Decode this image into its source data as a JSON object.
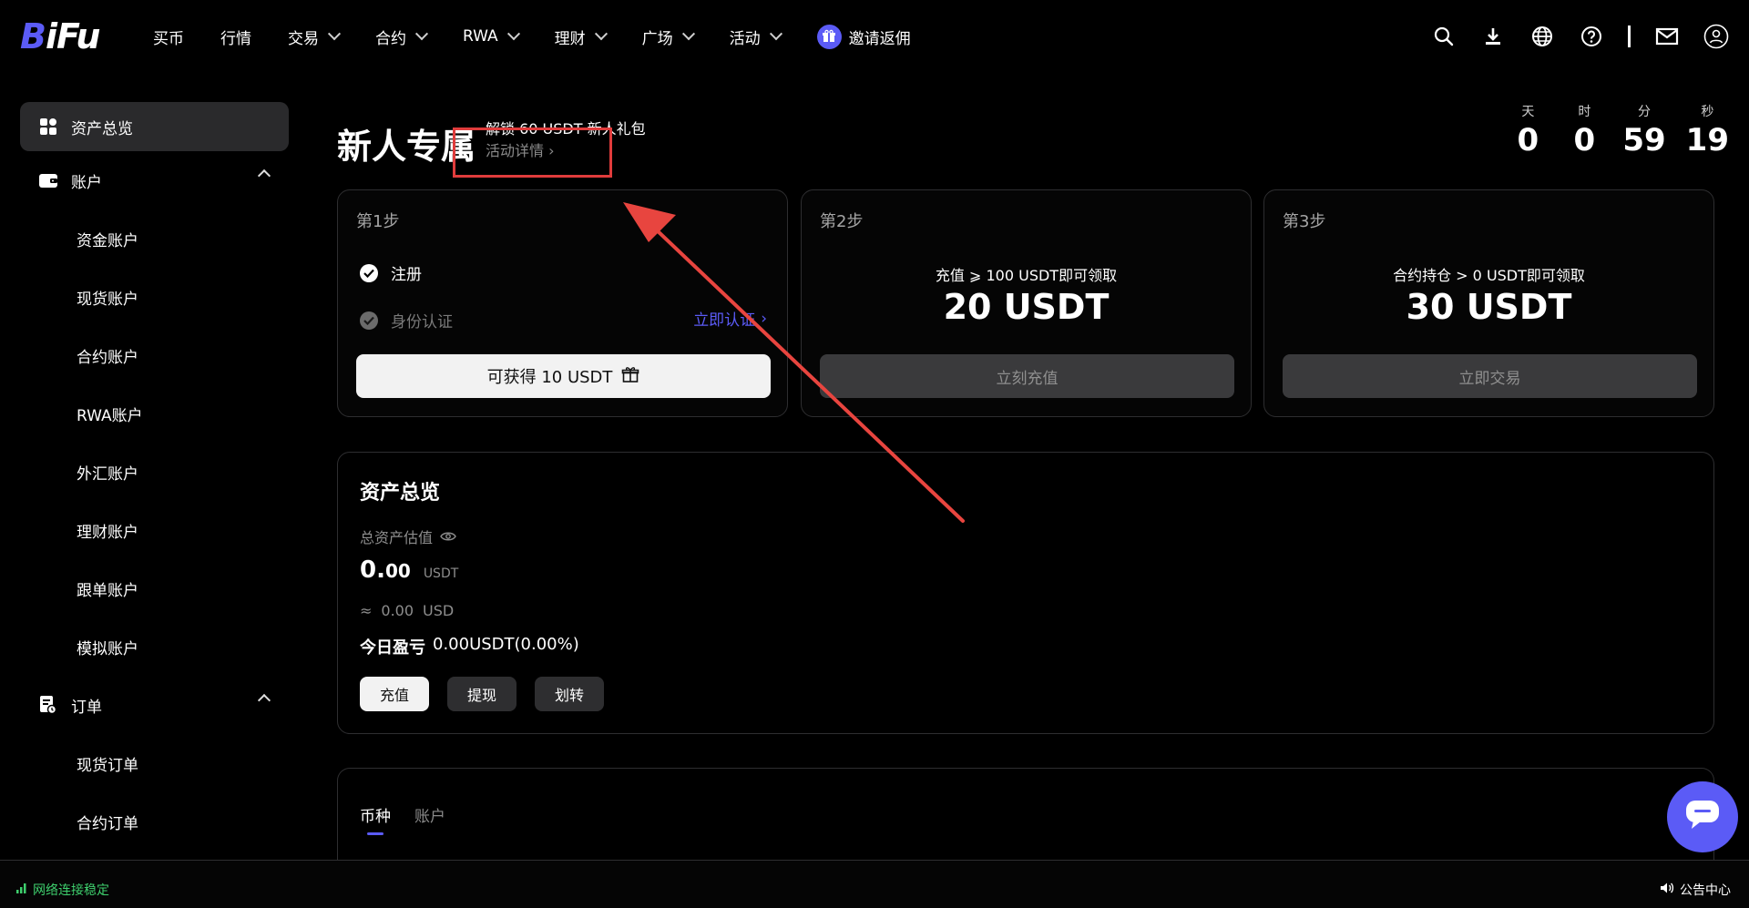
{
  "brand": {
    "logo_prefix": "B",
    "logo_rest": "iFu",
    "accent": "#5b5bf6"
  },
  "nav": {
    "items": [
      {
        "label": "买币",
        "dropdown": false
      },
      {
        "label": "行情",
        "dropdown": false
      },
      {
        "label": "交易",
        "dropdown": true
      },
      {
        "label": "合约",
        "dropdown": true
      },
      {
        "label": "RWA",
        "dropdown": true
      },
      {
        "label": "理财",
        "dropdown": true
      },
      {
        "label": "广场",
        "dropdown": true
      },
      {
        "label": "活动",
        "dropdown": true
      }
    ],
    "invite_label": "邀请返佣"
  },
  "top_icons": [
    "search-icon",
    "download-icon",
    "globe-icon",
    "help-icon",
    "mail-icon",
    "user-icon"
  ],
  "sidebar": {
    "overview": "资产总览",
    "account_group": "账户",
    "accounts": [
      "资金账户",
      "现货账户",
      "合约账户",
      "RWA账户",
      "外汇账户",
      "理财账户",
      "跟单账户",
      "模拟账户"
    ],
    "order_group": "订单",
    "orders": [
      "现货订单",
      "合约订单"
    ]
  },
  "promo": {
    "title": "新人专属",
    "subtitle": "解锁 60 USDT 新人礼包",
    "details_link": "活动详情"
  },
  "countdown": {
    "days_label": "天",
    "days": "0",
    "hours_label": "时",
    "hours": "0",
    "minutes_label": "分",
    "minutes": "59",
    "seconds_label": "秒",
    "seconds": "19"
  },
  "steps": [
    {
      "label": "第1步",
      "task1": "注册",
      "task2": "身份认证",
      "verify_link": "立即认证",
      "button": "可获得 10 USDT"
    },
    {
      "label": "第2步",
      "condition": "充值 ⩾ 100 USDT即可领取",
      "reward": "20 USDT",
      "button": "立刻充值"
    },
    {
      "label": "第3步",
      "condition": "合约持仓 > 0 USDT即可领取",
      "reward": "30 USDT",
      "button": "立即交易"
    }
  ],
  "asset": {
    "title": "资产总览",
    "est_label": "总资产估值",
    "value_int": "0.",
    "value_dec": "00",
    "unit": "USDT",
    "approx_symbol": "≈",
    "usd_value": "0.00",
    "usd_unit": "USD",
    "pnl_label": "今日盈亏",
    "pnl_value": "0.00USDT(0.00%)",
    "buttons": {
      "deposit": "充值",
      "withdraw": "提现",
      "transfer": "划转"
    }
  },
  "tabs": [
    "币种",
    "账户"
  ],
  "footer": {
    "network": "网络连接稳定",
    "notice": "公告中心"
  }
}
